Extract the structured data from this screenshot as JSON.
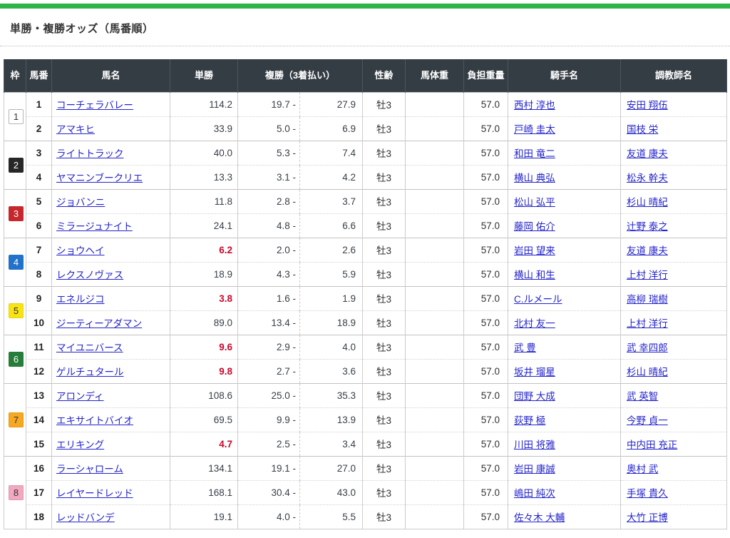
{
  "page": {
    "title": "単勝・複勝オッズ（馬番順）",
    "accent_color": "#2db347"
  },
  "table": {
    "headers": {
      "waku": "枠",
      "num": "馬番",
      "name": "馬名",
      "win": "単勝",
      "place": "複勝（3着払い）",
      "sex_age": "性齢",
      "weight": "馬体重",
      "load": "負担重量",
      "jockey": "騎手名",
      "trainer": "調教師名"
    },
    "place_separator": "-",
    "hot_odds_color": "#c9082a",
    "link_color": "#2424cc",
    "frame_styles": {
      "1": {
        "bg": "#ffffff",
        "fg": "#333333",
        "border": "#b5b5b5"
      },
      "2": {
        "bg": "#272727",
        "fg": "#ffffff",
        "border": "#272727"
      },
      "3": {
        "bg": "#c5272d",
        "fg": "#ffffff",
        "border": "#c5272d"
      },
      "4": {
        "bg": "#2172c8",
        "fg": "#ffffff",
        "border": "#2172c8"
      },
      "5": {
        "bg": "#f8e315",
        "fg": "#333333",
        "border": "#e8d314"
      },
      "6": {
        "bg": "#267d3a",
        "fg": "#ffffff",
        "border": "#267d3a"
      },
      "7": {
        "bg": "#f7a823",
        "fg": "#333333",
        "border": "#e79813"
      },
      "8": {
        "bg": "#f2a8bf",
        "fg": "#333333",
        "border": "#e298af"
      }
    },
    "rows": [
      {
        "frame": 1,
        "num": "1",
        "name": "コーチェラバレー",
        "win": "114.2",
        "place_low": "19.7",
        "place_high": "27.9",
        "sex_age": "牡3",
        "weight": "",
        "load": "57.0",
        "jockey": "西村 淳也",
        "trainer": "安田 翔伍"
      },
      {
        "frame": 1,
        "num": "2",
        "name": "アマキヒ",
        "win": "33.9",
        "place_low": "5.0",
        "place_high": "6.9",
        "sex_age": "牡3",
        "weight": "",
        "load": "57.0",
        "jockey": "戸崎 圭太",
        "trainer": "国枝 栄"
      },
      {
        "frame": 2,
        "num": "3",
        "name": "ライトトラック",
        "win": "40.0",
        "place_low": "5.3",
        "place_high": "7.4",
        "sex_age": "牡3",
        "weight": "",
        "load": "57.0",
        "jockey": "和田 竜二",
        "trainer": "友道 康夫"
      },
      {
        "frame": 2,
        "num": "4",
        "name": "ヤマニンブークリエ",
        "win": "13.3",
        "place_low": "3.1",
        "place_high": "4.2",
        "sex_age": "牡3",
        "weight": "",
        "load": "57.0",
        "jockey": "横山 典弘",
        "trainer": "松永 幹夫"
      },
      {
        "frame": 3,
        "num": "5",
        "name": "ジョバンニ",
        "win": "11.8",
        "place_low": "2.8",
        "place_high": "3.7",
        "sex_age": "牡3",
        "weight": "",
        "load": "57.0",
        "jockey": "松山 弘平",
        "trainer": "杉山 晴紀"
      },
      {
        "frame": 3,
        "num": "6",
        "name": "ミラージュナイト",
        "win": "24.1",
        "place_low": "4.8",
        "place_high": "6.6",
        "sex_age": "牡3",
        "weight": "",
        "load": "57.0",
        "jockey": "藤岡 佑介",
        "trainer": "辻野 泰之"
      },
      {
        "frame": 4,
        "num": "7",
        "name": "ショウヘイ",
        "win": "6.2",
        "place_low": "2.0",
        "place_high": "2.6",
        "sex_age": "牡3",
        "weight": "",
        "load": "57.0",
        "jockey": "岩田 望来",
        "trainer": "友道 康夫"
      },
      {
        "frame": 4,
        "num": "8",
        "name": "レクスノヴァス",
        "win": "18.9",
        "place_low": "4.3",
        "place_high": "5.9",
        "sex_age": "牡3",
        "weight": "",
        "load": "57.0",
        "jockey": "横山 和生",
        "trainer": "上村 洋行"
      },
      {
        "frame": 5,
        "num": "9",
        "name": "エネルジコ",
        "win": "3.8",
        "place_low": "1.6",
        "place_high": "1.9",
        "sex_age": "牡3",
        "weight": "",
        "load": "57.0",
        "jockey": "C.ルメール",
        "trainer": "高柳 瑞樹"
      },
      {
        "frame": 5,
        "num": "10",
        "name": "ジーティーアダマン",
        "win": "89.0",
        "place_low": "13.4",
        "place_high": "18.9",
        "sex_age": "牡3",
        "weight": "",
        "load": "57.0",
        "jockey": "北村 友一",
        "trainer": "上村 洋行"
      },
      {
        "frame": 6,
        "num": "11",
        "name": "マイユニバース",
        "win": "9.6",
        "place_low": "2.9",
        "place_high": "4.0",
        "sex_age": "牡3",
        "weight": "",
        "load": "57.0",
        "jockey": "武 豊",
        "trainer": "武 幸四郎"
      },
      {
        "frame": 6,
        "num": "12",
        "name": "ゲルチュタール",
        "win": "9.8",
        "place_low": "2.7",
        "place_high": "3.6",
        "sex_age": "牡3",
        "weight": "",
        "load": "57.0",
        "jockey": "坂井 瑠星",
        "trainer": "杉山 晴紀"
      },
      {
        "frame": 7,
        "num": "13",
        "name": "アロンディ",
        "win": "108.6",
        "place_low": "25.0",
        "place_high": "35.3",
        "sex_age": "牡3",
        "weight": "",
        "load": "57.0",
        "jockey": "団野 大成",
        "trainer": "武 英智"
      },
      {
        "frame": 7,
        "num": "14",
        "name": "エキサイトバイオ",
        "win": "69.5",
        "place_low": "9.9",
        "place_high": "13.9",
        "sex_age": "牡3",
        "weight": "",
        "load": "57.0",
        "jockey": "荻野 極",
        "trainer": "今野 貞一"
      },
      {
        "frame": 7,
        "num": "15",
        "name": "エリキング",
        "win": "4.7",
        "place_low": "2.5",
        "place_high": "3.4",
        "sex_age": "牡3",
        "weight": "",
        "load": "57.0",
        "jockey": "川田 将雅",
        "trainer": "中内田 充正"
      },
      {
        "frame": 8,
        "num": "16",
        "name": "ラーシャローム",
        "win": "134.1",
        "place_low": "19.1",
        "place_high": "27.0",
        "sex_age": "牡3",
        "weight": "",
        "load": "57.0",
        "jockey": "岩田 康誠",
        "trainer": "奥村 武"
      },
      {
        "frame": 8,
        "num": "17",
        "name": "レイヤードレッド",
        "win": "168.1",
        "place_low": "30.4",
        "place_high": "43.0",
        "sex_age": "牡3",
        "weight": "",
        "load": "57.0",
        "jockey": "嶋田 純次",
        "trainer": "手塚 貴久"
      },
      {
        "frame": 8,
        "num": "18",
        "name": "レッドバンデ",
        "win": "19.1",
        "place_low": "4.0",
        "place_high": "5.5",
        "sex_age": "牡3",
        "weight": "",
        "load": "57.0",
        "jockey": "佐々木 大輔",
        "trainer": "大竹 正博"
      }
    ]
  }
}
